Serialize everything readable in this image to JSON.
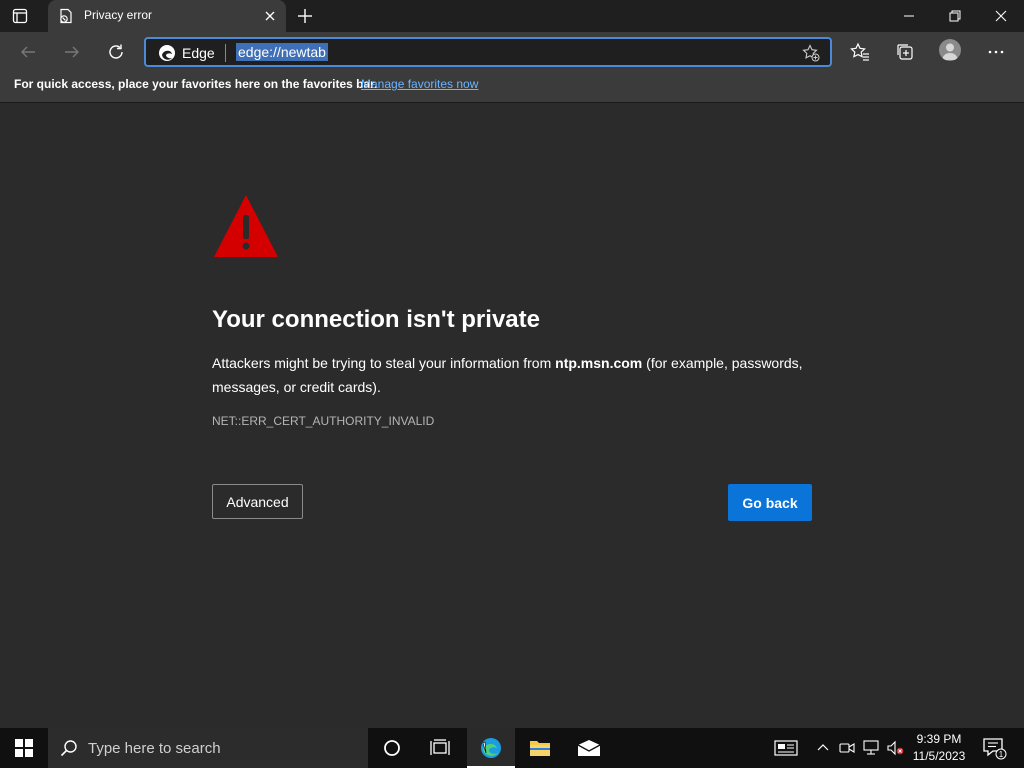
{
  "tab": {
    "title": "Privacy error"
  },
  "addressbar": {
    "site_label": "Edge",
    "url": "edge://newtab"
  },
  "favorites_bar": {
    "message": "For quick access, place your favorites here on the favorites bar.",
    "link": "Manage favorites now"
  },
  "error_page": {
    "heading": "Your connection isn't private",
    "message_before": "Attackers might be trying to steal your information from ",
    "host": "ntp.msn.com",
    "message_after": " (for example, passwords, messages, or credit cards).",
    "error_code": "NET::ERR_CERT_AUTHORITY_INVALID",
    "advanced_label": "Advanced",
    "go_back_label": "Go back"
  },
  "taskbar": {
    "search_placeholder": "Type here to search",
    "time": "9:39 PM",
    "date": "11/5/2023",
    "notification_count": "1"
  },
  "colors": {
    "accent_blue": "#0a74d8",
    "warning_red": "#d40000",
    "link_blue": "#6cb4ff"
  }
}
